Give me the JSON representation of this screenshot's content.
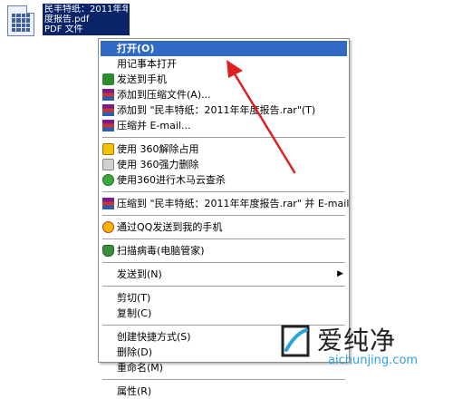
{
  "desktop_file": {
    "label_lines": [
      "民丰特纸：2011年年",
      "度报告.pdf",
      "PDF 文件"
    ]
  },
  "context_menu": {
    "items": [
      {
        "label": "打开(O)",
        "icon": "none"
      },
      {
        "label": "用记事本打开",
        "icon": "none"
      },
      {
        "label": "发送到手机",
        "icon": "phone-icon"
      },
      {
        "label": "添加到压缩文件(A)...",
        "icon": "winrar-icon"
      },
      {
        "label": "添加到 \"民丰特纸：2011年年度报告.rar\"(T)",
        "icon": "winrar-icon"
      },
      {
        "label": "压缩并 E-mail...",
        "icon": "winrar-icon"
      },
      {
        "label": "使用 360解除占用",
        "icon": "360-unlock-icon"
      },
      {
        "label": "使用 360强力删除",
        "icon": "360-delete-icon"
      },
      {
        "label": "使用360进行木马云查杀",
        "icon": "360-trojan-icon"
      },
      {
        "label": "压缩到 \"民丰特纸：2011年年度报告.rar\" 并 E-mail",
        "icon": "winrar-icon"
      },
      {
        "label": "通过QQ发送到我的手机",
        "icon": "qq-icon"
      },
      {
        "label": "扫描病毒(电脑管家)",
        "icon": "shield-icon"
      },
      {
        "label": "发送到(N)",
        "icon": "none"
      },
      {
        "label": "剪切(T)",
        "icon": "none"
      },
      {
        "label": "复制(C)",
        "icon": "none"
      },
      {
        "label": "创建快捷方式(S)",
        "icon": "none"
      },
      {
        "label": "删除(D)",
        "icon": "none"
      },
      {
        "label": "重命名(M)",
        "icon": "none"
      },
      {
        "label": "属性(R)",
        "icon": "none"
      }
    ]
  },
  "watermark": {
    "brand": "爱纯净",
    "url": "aichunjing.com"
  },
  "colors": {
    "highlight": "#316ac5",
    "annotation_arrow": "#e02020",
    "watermark_url": "#2aa3d8"
  }
}
